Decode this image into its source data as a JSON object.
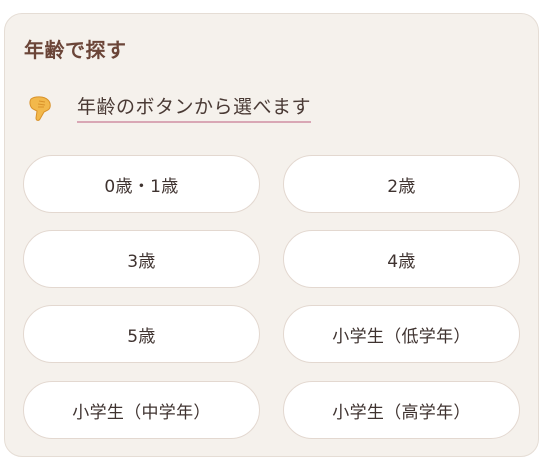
{
  "section": {
    "title": "年齢で探す",
    "hint_icon": "pointing-hand-icon",
    "hint_text": "年齢のボタンから選べます"
  },
  "age_buttons": [
    {
      "label": "0歳・1歳"
    },
    {
      "label": "2歳"
    },
    {
      "label": "3歳"
    },
    {
      "label": "4歳"
    },
    {
      "label": "5歳"
    },
    {
      "label": "小学生（低学年）"
    },
    {
      "label": "小学生（中学年）"
    },
    {
      "label": "小学生（高学年）"
    }
  ],
  "colors": {
    "card_background": "#f5f1ec",
    "title": "#6b4538",
    "hint_underline": "#d9a7b5",
    "button_background": "#ffffff",
    "button_border": "#e3d8d0",
    "hand_icon": "#f2b84b"
  }
}
